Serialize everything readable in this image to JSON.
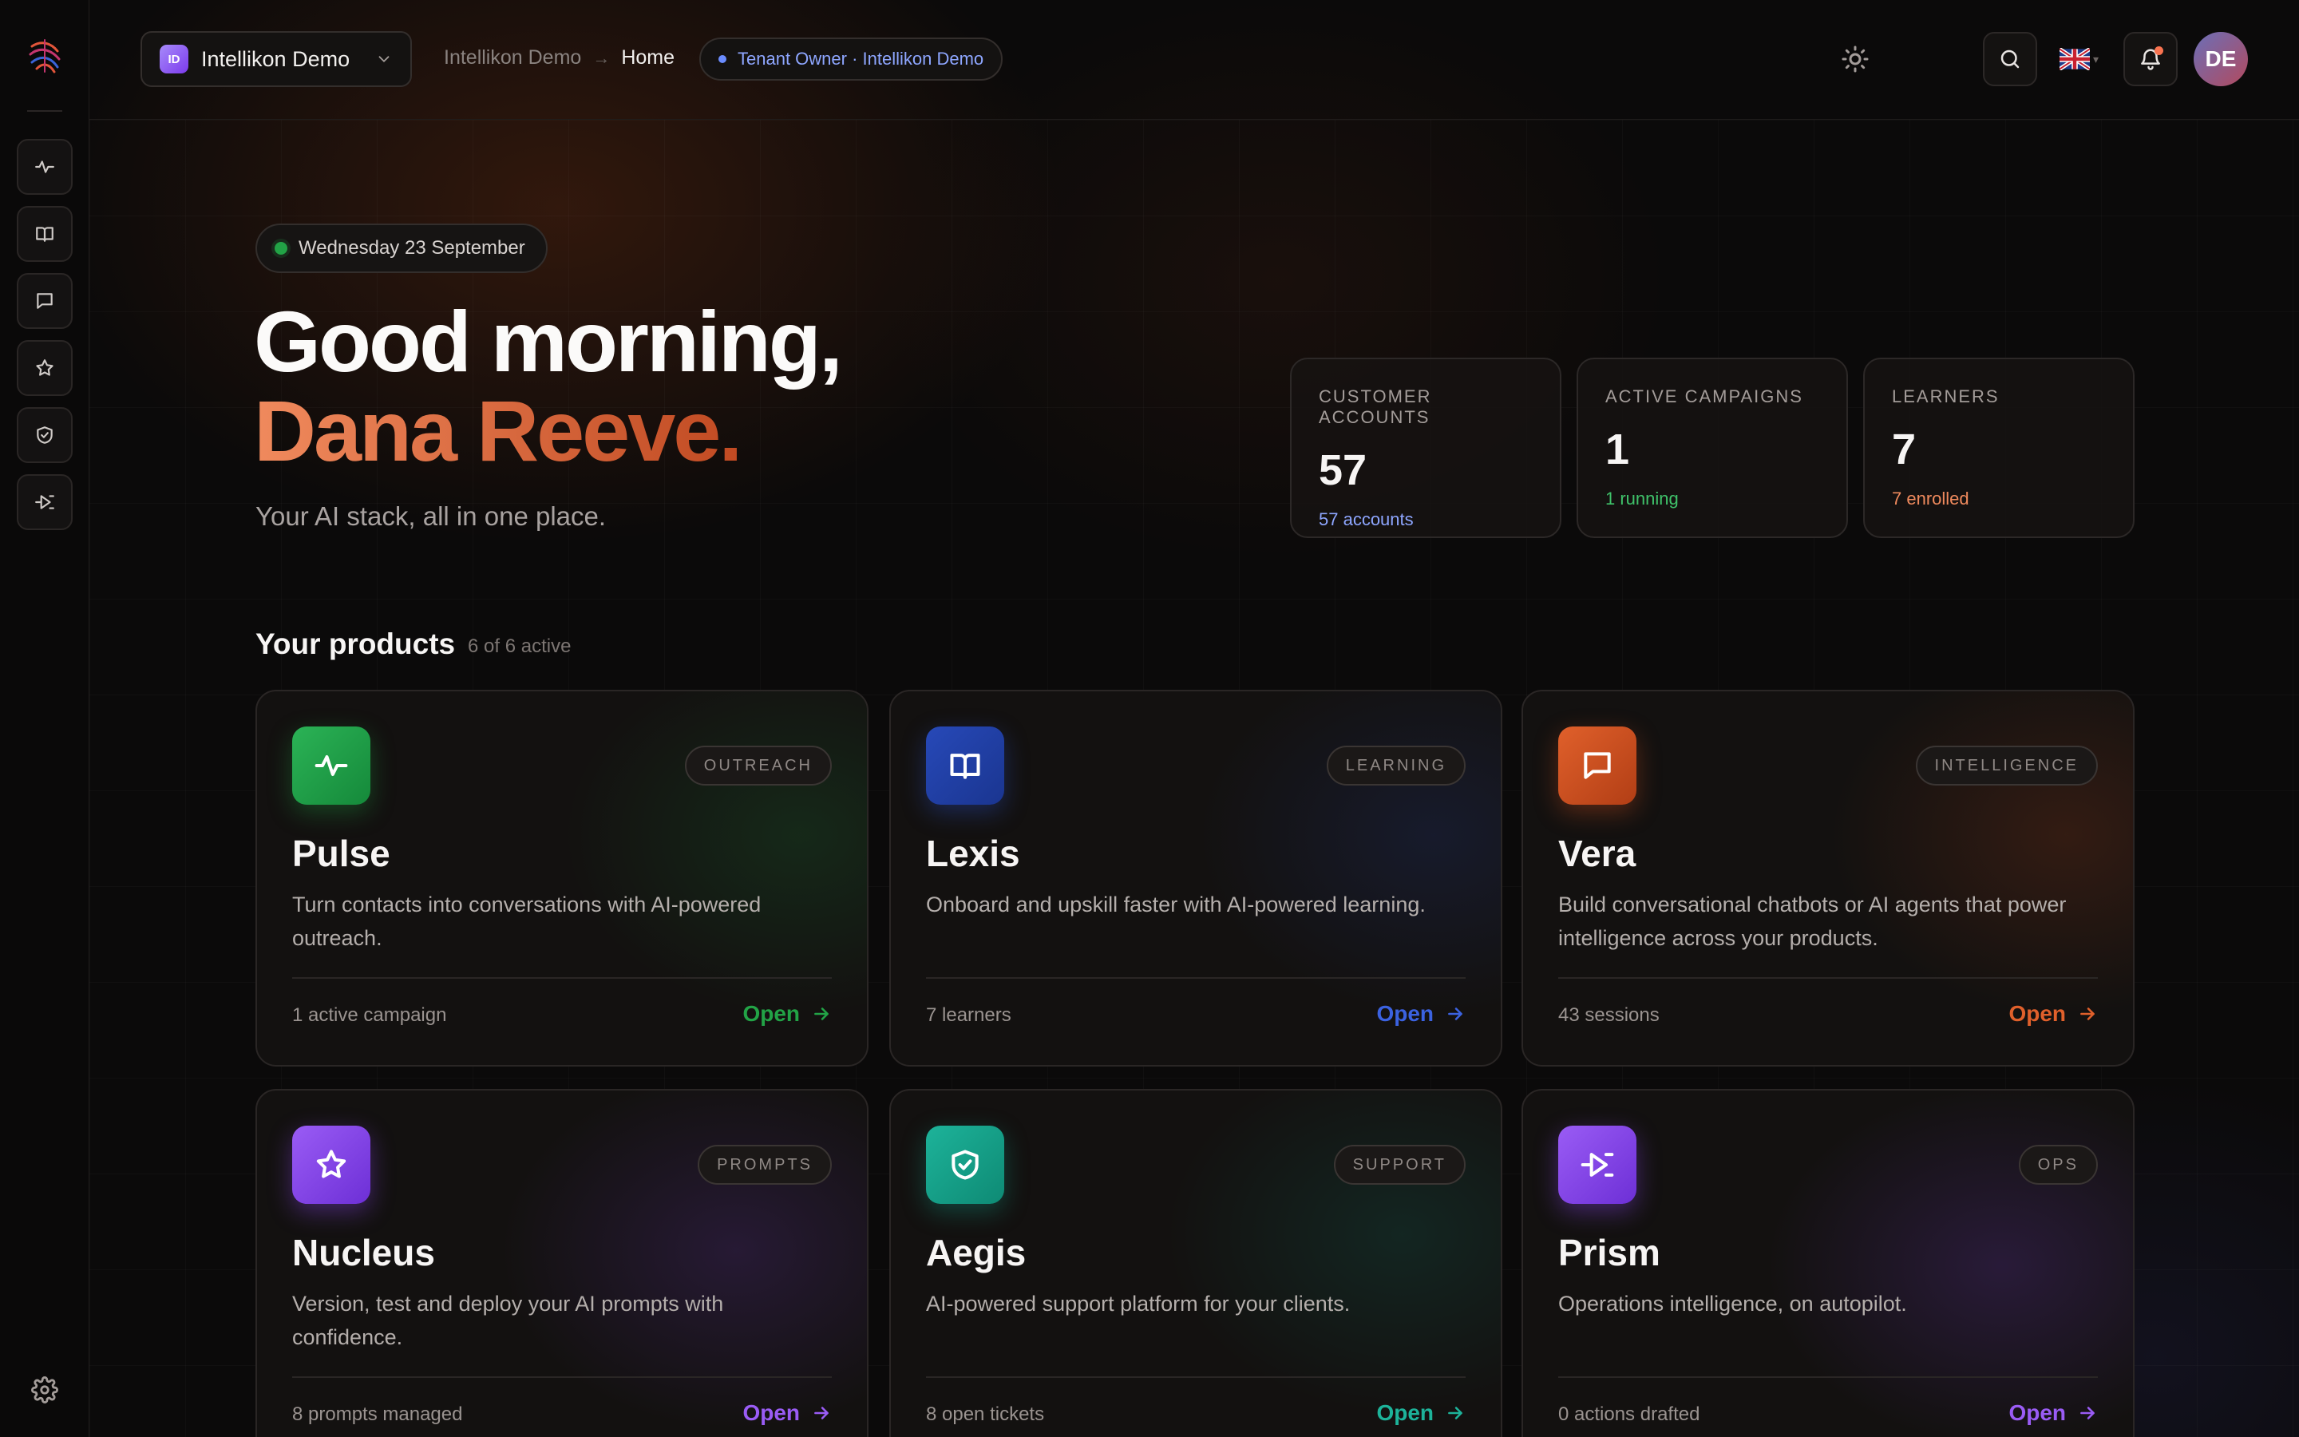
{
  "topbar": {
    "tenant_badge": "ID",
    "tenant_name": "Intellikon Demo",
    "breadcrumb_parent": "Intellikon Demo",
    "breadcrumb_sep": "→",
    "breadcrumb_current": "Home",
    "role": "Tenant Owner · Intellikon Demo",
    "avatar_initials": "DE",
    "language_chevron": "▾"
  },
  "hero": {
    "date": "Wednesday 23 September",
    "greeting": "Good morning,",
    "name": "Dana Reeve.",
    "tagline": "Your AI stack, all in one place."
  },
  "stats": [
    {
      "label": "CUSTOMER ACCOUNTS",
      "value": "57",
      "sub": "57 accounts",
      "color": "#8ea6ff"
    },
    {
      "label": "ACTIVE CAMPAIGNS",
      "value": "1",
      "sub": "1 running",
      "color": "#3fc26a"
    },
    {
      "label": "LEARNERS",
      "value": "7",
      "sub": "7 enrolled",
      "color": "#f08a5d"
    }
  ],
  "products": {
    "title": "Your products",
    "count": "6 of 6 active",
    "items": [
      {
        "name": "Pulse",
        "tag": "OUTREACH",
        "desc": "Turn contacts into conversations with AI-powered outreach.",
        "meta": "1 active campaign",
        "open": "Open",
        "accent": "#22a346",
        "icon": "pulse-icon"
      },
      {
        "name": "Lexis",
        "tag": "LEARNING",
        "desc": "Onboard and upskill faster with AI-powered learning.",
        "meta": "7 learners",
        "open": "Open",
        "accent": "#2f55d4",
        "icon": "book-icon"
      },
      {
        "name": "Vera",
        "tag": "INTELLIGENCE",
        "desc": "Build conversational chatbots or AI agents that power intelligence across your products.",
        "meta": "43 sessions",
        "open": "Open",
        "accent": "#d9521f",
        "icon": "chat-icon"
      },
      {
        "name": "Nucleus",
        "tag": "PROMPTS",
        "desc": "Version, test and deploy your AI prompts with confidence.",
        "meta": "8 prompts managed",
        "open": "Open",
        "accent": "#8b46f0",
        "icon": "star-icon"
      },
      {
        "name": "Aegis",
        "tag": "SUPPORT",
        "desc": "AI-powered support platform for your clients.",
        "meta": "8 open tickets",
        "open": "Open",
        "accent": "#14a38b",
        "icon": "shield-icon"
      },
      {
        "name": "Prism",
        "tag": "OPS",
        "desc": "Operations intelligence, on autopilot.",
        "meta": "0 actions drafted",
        "open": "Open",
        "accent": "#8b46f0",
        "icon": "prism-icon"
      }
    ]
  }
}
